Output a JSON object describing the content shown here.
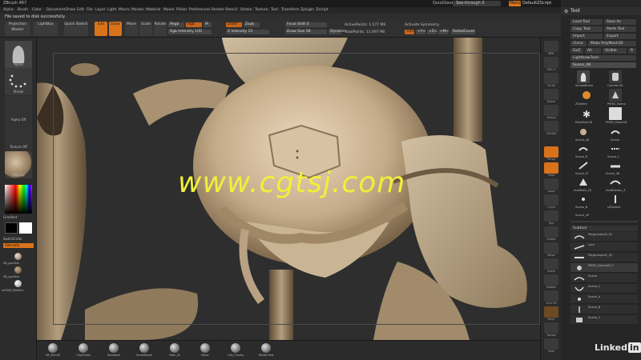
{
  "app": {
    "title": "ZBrush 4R7",
    "notice": "File saved to disk successfully.",
    "quicksave": "QuickSave",
    "see_through": "See-through  0",
    "menus": "Menus",
    "default_script": "DefaultZScript"
  },
  "menubar": [
    "Alpha",
    "Brush",
    "Color",
    "Document",
    "Draw",
    "Edit",
    "File",
    "Layer",
    "Light",
    "Macro",
    "Marker",
    "Material",
    "Movie",
    "Picker",
    "Preferences",
    "Render",
    "Stencil",
    "Stroke",
    "Texture",
    "Tool",
    "Transform",
    "Zplugin",
    "Zscript"
  ],
  "topshelf": {
    "projection_master": "Projection Master",
    "lightbox": "LightBox",
    "quick_sketch": "Quick Sketch",
    "edit": "Edit",
    "draw": "Draw",
    "move": "Move",
    "scale": "Scale",
    "rotate": "Rotate",
    "mrgb": "Mrgb",
    "rgb": "Rgb",
    "m": "M",
    "rgb_intensity": "Rgb Intensity 100",
    "zadd": "Zadd",
    "zsub": "Zsub",
    "z_intensity": "Z Intensity 15",
    "focal_shift": "Focal Shift 0",
    "draw_size": "Draw Size 58",
    "dynamic": "Dynamic",
    "active_points": "ActivePoints: 1.577 Mil",
    "total_points": "TotalPoints: 11.697 Mil",
    "activate_symmetry": "Activate Symmetry",
    "sym_x": ">X<",
    "sym_y": ">Y<",
    "sym_z": ">Z<",
    "sym_m": ">M<",
    "radial_count": "RadialCount"
  },
  "lefttray": {
    "tile1_label": "Alpha",
    "tile2_label": "Stroke",
    "tile3_label": "Alpha Off",
    "tile4_label": "Texture Off",
    "tile5_label": "MatCap",
    "gradient": "Gradient",
    "switch_color": "SwitchColor",
    "alternate": "Alternate",
    "mat1": "SB_ppcSkin",
    "mat2": "SB_ppcSkin",
    "mat3": "enRGB_MatSkin"
  },
  "rightshelf": {
    "btn1": "BPR",
    "btn2": "SPix 3",
    "btn3": "Scroll",
    "btn4": "Zoom",
    "btn5": "Actual",
    "btn6": "AAHalf",
    "btn7": "Persp",
    "btn8": "Floor",
    "btn9": "Local",
    "btn10": "L.Sym",
    "btn11": "Xyz",
    "btn12": "Frame",
    "btn13": "Move",
    "btn14": "Scale",
    "btn15": "Rotate",
    "btn16": "Line Fill",
    "btn17": "PolyF",
    "btn18": "Transp",
    "btn19": "Ghost",
    "btn20": "Solo",
    "btn21": "Xpose"
  },
  "rightpanel": {
    "tool_title": "Tool",
    "load_tool": "Load Tool",
    "save_as": "Save As",
    "copy_tool": "Copy Tool",
    "paste_tool": "Paste Tool",
    "import": "Import",
    "export": "Export",
    "clone": "Clone",
    "make_polymesh": "Make PolyMesh3D",
    "goz": "GoZ",
    "all": "All",
    "visible": "Visible",
    "r": "R",
    "lightbox_tools": "Lightbox▸Tools",
    "current_tool": "Sueno_48",
    "thumbs": [
      "SimpleBrush",
      "Cylinder3D",
      "ZSphere",
      "PM3D_Sueno",
      "PolyMesh3D",
      "PM3D_Plane3D",
      "Sueno_48",
      "Sueno",
      "Sueno_R",
      "Sueno_L",
      "Sueno_M",
      "Sueno_48",
      "SueMesh_18",
      "SubDivision_3",
      "Sueno_B",
      "sZSphere",
      "Sueno_49"
    ],
    "subtool_header": "Subtool",
    "subtools": [
      "Polygrouped2_01",
      "Lace",
      "Polygrouped1_02",
      "PM3D_Sueno2D_3",
      "Sueno",
      "Sueno_1",
      "Sueno_A",
      "Sueno_B",
      "Sueno_C"
    ]
  },
  "bottomstrip": {
    "brushes": [
      "SB_Skin30",
      "ClayTubes",
      "Standard",
      "SnakeHook",
      "Dam_St",
      "Move",
      "Orb_Cracks",
      "Mallet Fast"
    ]
  },
  "watermark": "www.cgtsj.com",
  "linkedin": "Linked",
  "linkedin_in": "in"
}
